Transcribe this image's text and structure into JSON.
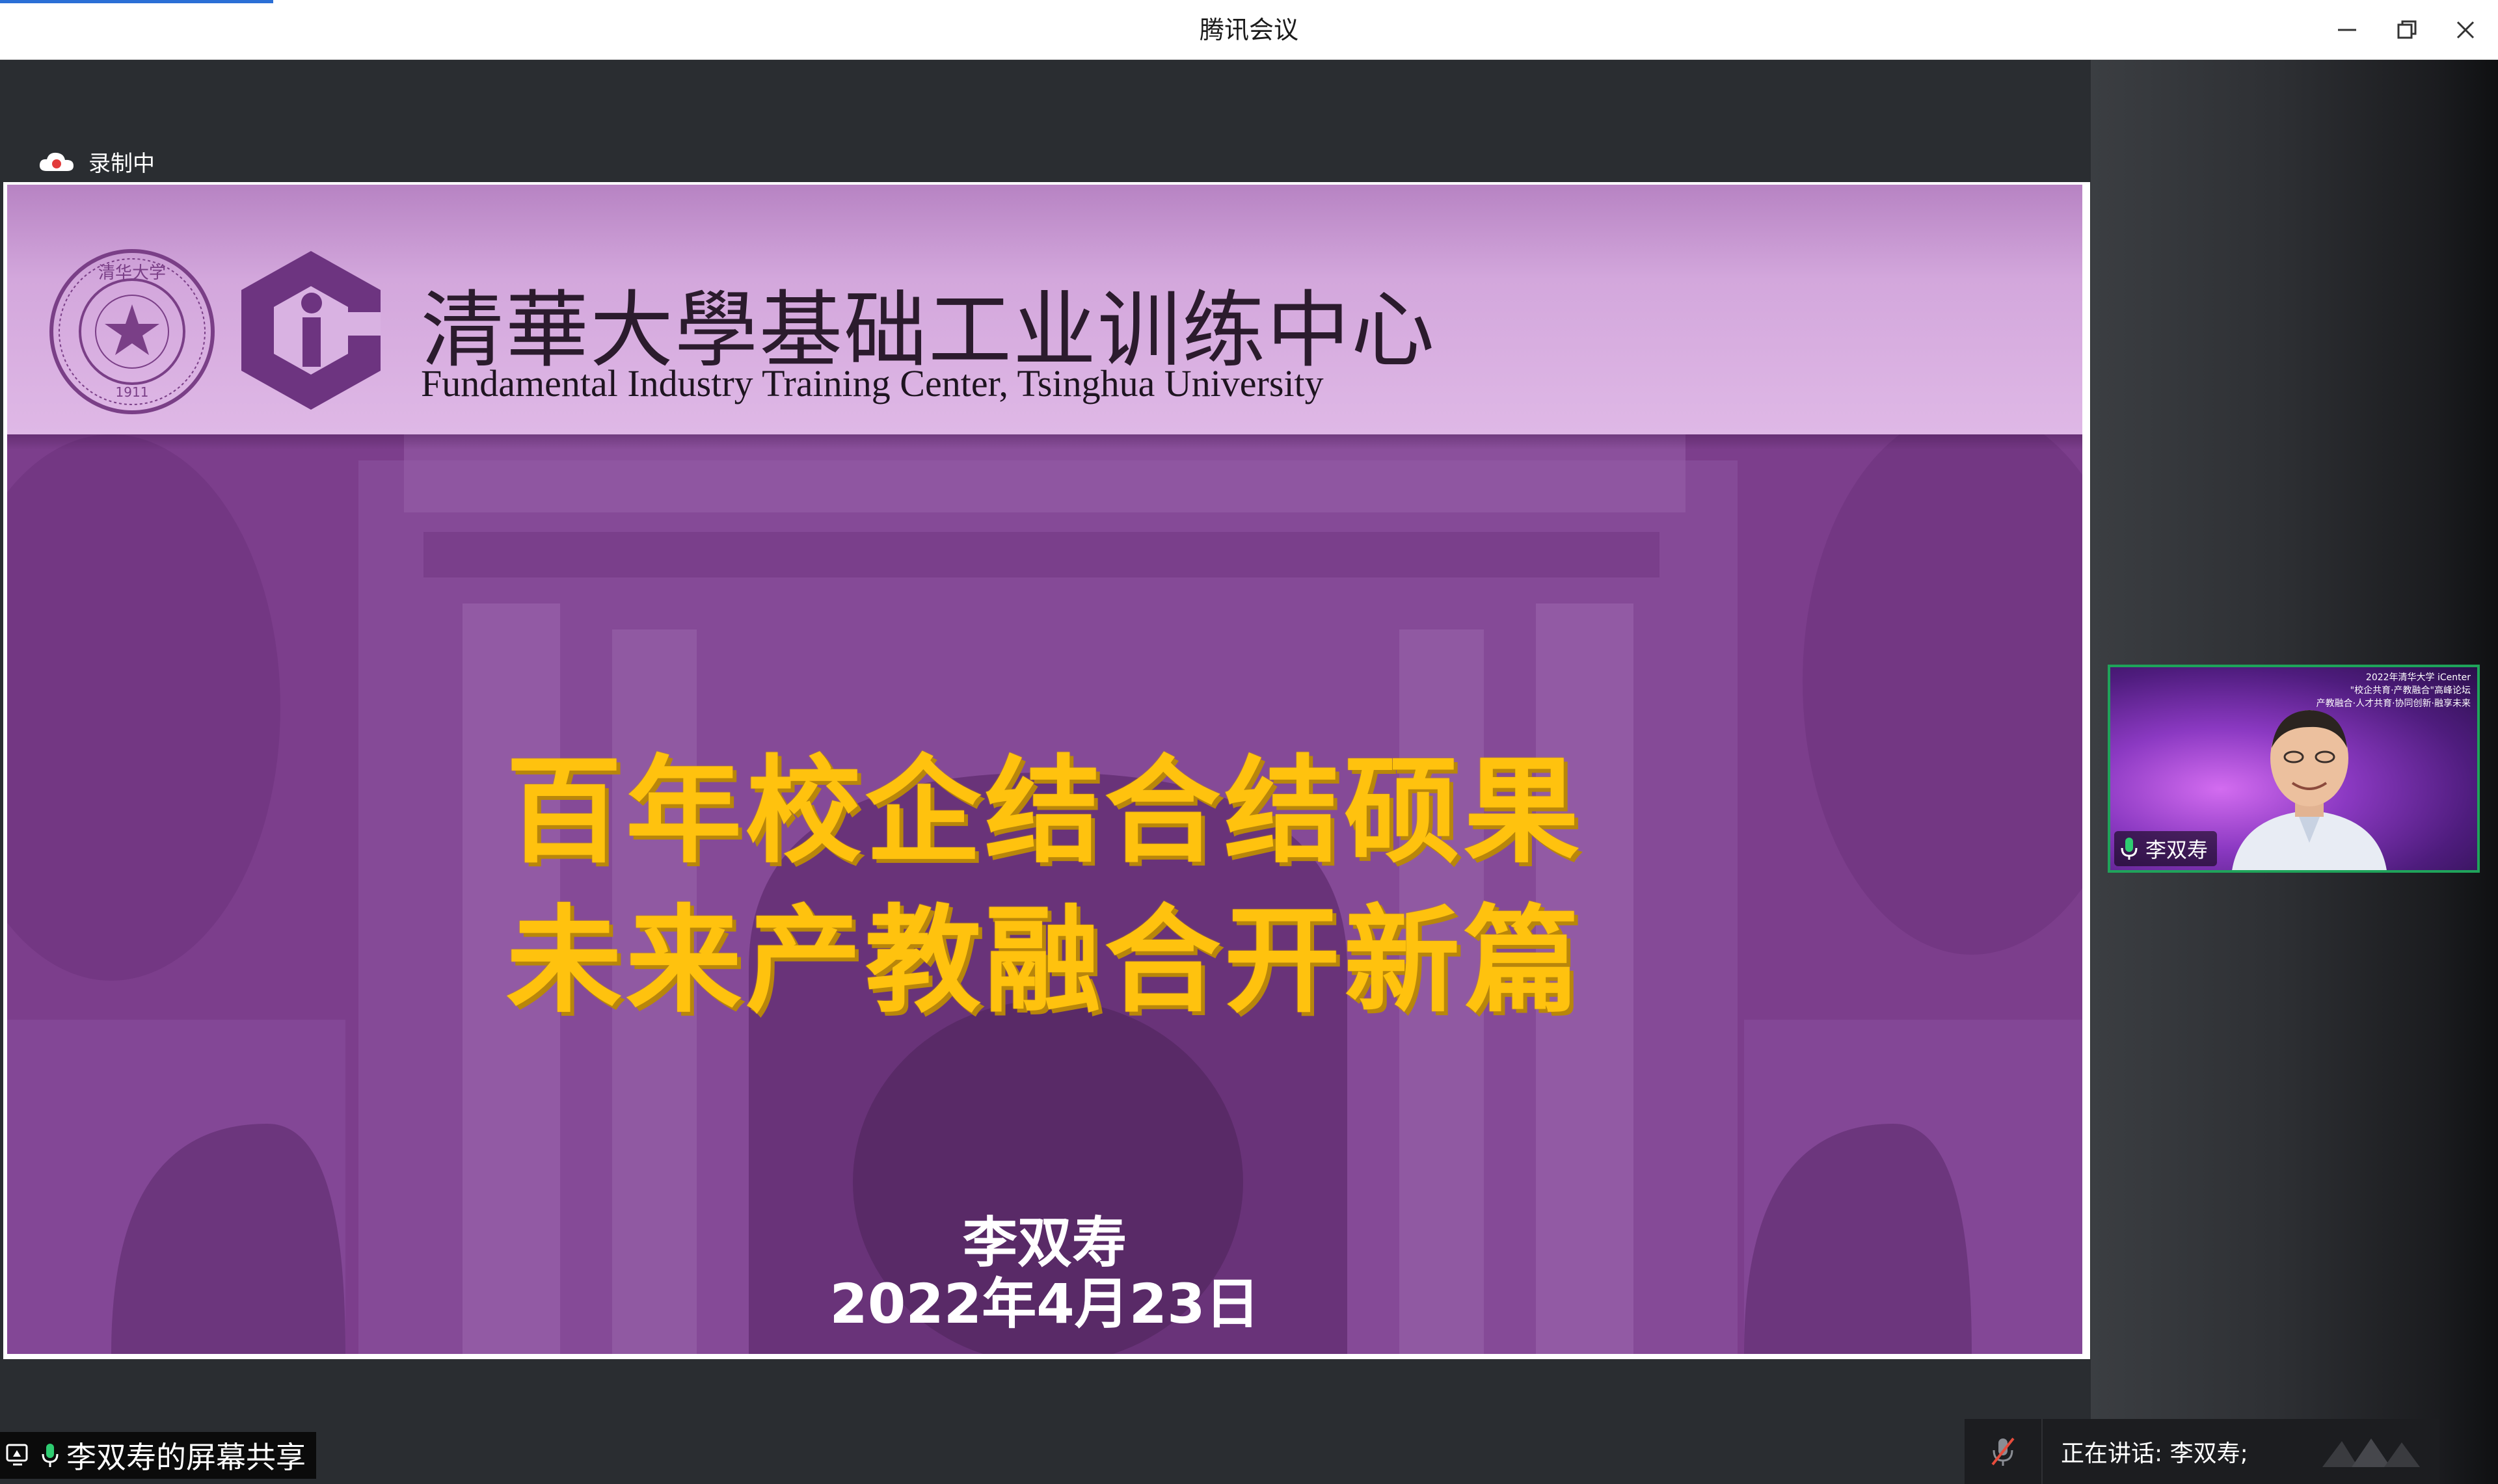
{
  "window": {
    "title": "腾讯会议",
    "controls": {
      "minimize_icon": "minimize-icon",
      "restore_icon": "restore-icon",
      "close_icon": "close-icon"
    }
  },
  "recording": {
    "label": "录制中",
    "icon": "cloud-record-icon"
  },
  "slide": {
    "org_name_cn": "清華大學基础工业训练中心",
    "org_name_en": "Fundamental Industry Training Center, Tsinghua University",
    "headline_line1": "百年校企结合结硕果",
    "headline_line2": "未来产教融合开新篇",
    "presenter": "李双寿",
    "date": "2022年4月23日",
    "controls": [
      "prev-icon",
      "next-icon",
      "pen-icon",
      "slides-icon",
      "zoom-icon",
      "more-icon"
    ]
  },
  "participant": {
    "name": "李双寿",
    "banner_line1": "2022年清华大学 iCenter",
    "banner_line2": "\"校企共育·产教融合\"高峰论坛",
    "banner_line3": "产教融合·人才共育·协同创新·融享未来"
  },
  "share": {
    "label": "李双寿的屏幕共享"
  },
  "speaking": {
    "label": "正在讲话: 李双寿;"
  },
  "colors": {
    "slide_purple": "#7d3f8d",
    "headline_yellow": "#ffc20e",
    "tile_border": "#1fa35a",
    "stage_bg": "#2a2d31"
  }
}
